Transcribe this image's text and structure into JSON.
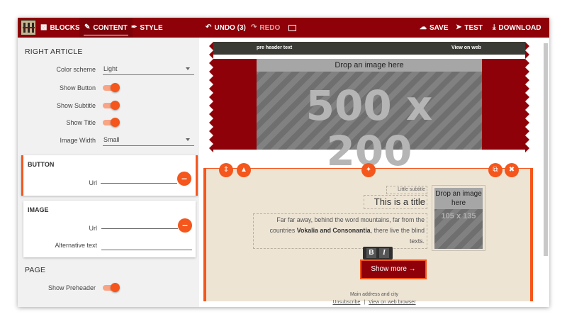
{
  "toolbar": {
    "blocks": "BLOCKS",
    "content": "CONTENT",
    "style": "STYLE",
    "undo": "UNDO (3)",
    "redo": "REDO",
    "save": "SAVE",
    "test": "TEST",
    "download": "DOWNLOAD"
  },
  "sidebar": {
    "section_title": "RIGHT ARTICLE",
    "color_scheme_label": "Color scheme",
    "color_scheme_value": "Light",
    "show_button_label": "Show Button",
    "show_subtitle_label": "Show Subtitle",
    "show_title_label": "Show Title",
    "image_width_label": "Image Width",
    "image_width_value": "Small",
    "button_card": {
      "title": "BUTTON",
      "url_label": "Url"
    },
    "image_card": {
      "title": "IMAGE",
      "url_label": "Url",
      "alt_label": "Alternative text"
    },
    "page_title": "PAGE",
    "show_preheader_label": "Show Preheader"
  },
  "preview": {
    "preheader_text": "pre header text",
    "view_on_web": "View on web",
    "hero_drop": "Drop an image here",
    "hero_size": "500 x 200",
    "little_subtitle": "Little subtitle",
    "title": "This is a title",
    "body_before": "Far far away, behind the word mountains, far from the countries ",
    "body_bold": "Vokalia and Consonantia",
    "body_after": ", there live the blind texts.",
    "thumb_drop": "Drop an image here",
    "thumb_size": "105 x 135",
    "bold_btn": "B",
    "italic_btn": "I",
    "show_more": "Show more →",
    "footer_address": "Main address and city",
    "footer_unsubscribe": "Unsubscribe",
    "footer_sep": "|",
    "footer_view_browser": "View on web browser"
  },
  "colors": {
    "brand": "#8f0109",
    "accent": "#f4561c",
    "article_bg": "#ede4d4"
  },
  "icons": [
    "blocks-icon",
    "pencil-icon",
    "brush-icon",
    "undo-icon",
    "redo-icon",
    "image-icon",
    "cloud-save-icon",
    "send-icon",
    "download-icon",
    "up-down-icon",
    "up-icon",
    "magic-wand-icon",
    "copy-icon",
    "trash-icon",
    "minus-icon"
  ]
}
